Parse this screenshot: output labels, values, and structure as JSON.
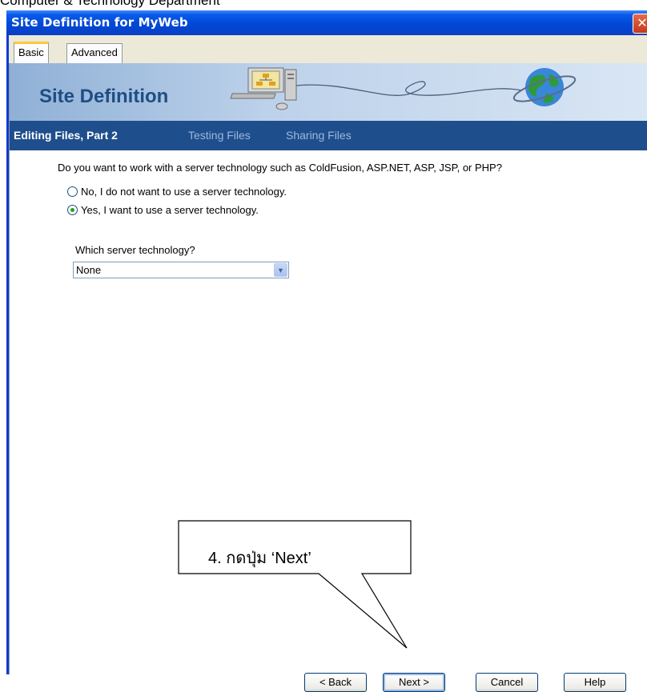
{
  "page_header": "Computer & Technology Department",
  "window": {
    "title": "Site Definition for MyWeb",
    "close_glyph": "✕"
  },
  "tabs": [
    {
      "label": "Basic",
      "active": true
    },
    {
      "label": "Advanced",
      "active": false
    }
  ],
  "banner": {
    "title": "Site Definition",
    "icons": [
      "network-computer-icon",
      "globe-icon"
    ]
  },
  "steps": [
    {
      "label": "Editing Files, Part 2",
      "current": true
    },
    {
      "label": "Testing Files",
      "current": false
    },
    {
      "label": "Sharing Files",
      "current": false
    }
  ],
  "question": "Do you want to work with a server technology such as ColdFusion, ASP.NET, ASP, JSP, or PHP?",
  "options": [
    {
      "label": "No, I do not want to use a server technology.",
      "checked": false
    },
    {
      "label": "Yes, I want to use a server technology.",
      "checked": true
    }
  ],
  "server_tech": {
    "label": "Which server technology?",
    "value": "None"
  },
  "buttons": {
    "back": "< Back",
    "next": "Next >",
    "cancel": "Cancel",
    "help": "Help"
  },
  "callout": {
    "text": "4.  กดปุ่ม ‘Next’"
  }
}
